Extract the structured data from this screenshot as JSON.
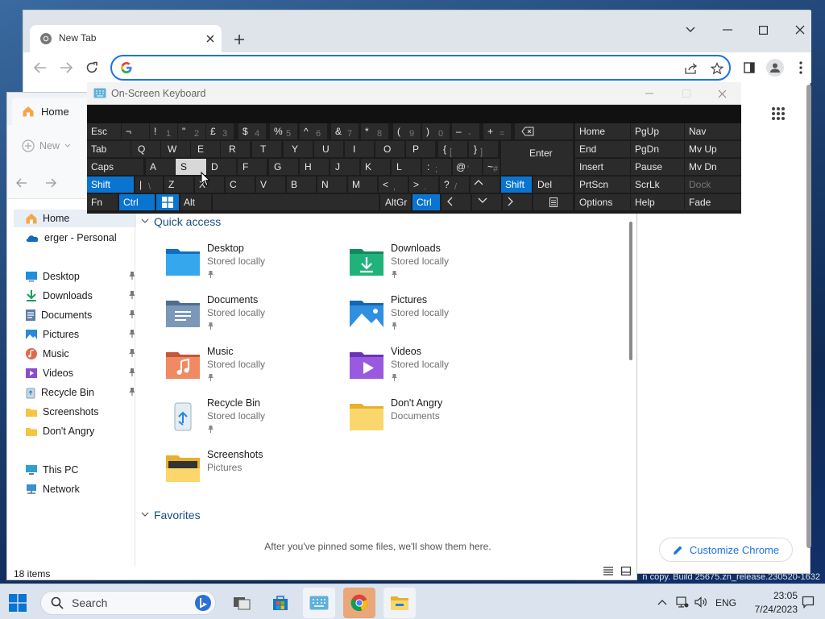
{
  "watermark": "n copy. Build 25675.zn_release.230520-1632",
  "chrome": {
    "tab_title": "New Tab",
    "omnibox_value": "",
    "customize_label": "Customize Chrome"
  },
  "explorer": {
    "tab_title": "Home",
    "new_label": "New",
    "nav": {
      "home": "Home",
      "onedrive": "erger - Personal",
      "desktop": "Desktop",
      "downloads": "Downloads",
      "documents": "Documents",
      "pictures": "Pictures",
      "music": "Music",
      "videos": "Videos",
      "recycle_bin": "Recycle Bin",
      "screenshots": "Screenshots",
      "dont_angry": "Don't Angry",
      "this_pc": "This PC",
      "network": "Network"
    },
    "quick_access_title": "Quick access",
    "quick_access": [
      {
        "name": "Desktop",
        "sub": "Stored locally"
      },
      {
        "name": "Downloads",
        "sub": "Stored locally"
      },
      {
        "name": "Documents",
        "sub": "Stored locally"
      },
      {
        "name": "Pictures",
        "sub": "Stored locally"
      },
      {
        "name": "Music",
        "sub": "Stored locally"
      },
      {
        "name": "Videos",
        "sub": "Stored locally"
      },
      {
        "name": "Recycle Bin",
        "sub": "Stored locally"
      },
      {
        "name": "Don't Angry",
        "sub": "Documents"
      },
      {
        "name": "Screenshots",
        "sub": "Pictures"
      }
    ],
    "favorites_title": "Favorites",
    "favorites_empty": "After you've pinned some files, we'll show them here.",
    "status_items": "18 items"
  },
  "osk": {
    "title": "On-Screen Keyboard",
    "keys": {
      "esc": "Esc",
      "not": "¬",
      "k1": "!",
      "k1s": "1",
      "k2": "\"",
      "k2s": "2",
      "k3": "£",
      "k3s": "3",
      "k4": "$",
      "k4s": "4",
      "k5": "%",
      "k5s": "5",
      "k6": "^",
      "k6s": "6",
      "k7": "&",
      "k7s": "7",
      "k8": "*",
      "k8s": "8",
      "k9": "(",
      "k9s": "9",
      "k0": ")",
      "k0s": "0",
      "minus": "–",
      "minuss": "-",
      "plus": "+",
      "pluss": "=",
      "tab": "Tab",
      "q": "Q",
      "w": "W",
      "e": "E",
      "r": "R",
      "t": "T",
      "y": "Y",
      "u": "U",
      "i": "I",
      "o": "O",
      "p": "P",
      "lbrace": "{",
      "lbraces": "[",
      "rbrace": "}",
      "rbraces": "]",
      "enter": "Enter",
      "caps": "Caps",
      "a": "A",
      "s": "S",
      "d": "D",
      "f": "F",
      "g": "G",
      "h": "H",
      "j": "J",
      "k": "K",
      "l": "L",
      "colon": ":",
      "colons": ";",
      "at": "@",
      "ats": "'",
      "tilde": "~",
      "tildes": "#",
      "shift": "Shift",
      "pipe": "|",
      "pipes": "\\",
      "z": "Z",
      "x": "X",
      "c": "C",
      "v": "V",
      "b": "B",
      "n": "N",
      "m": "M",
      "lt": "<",
      "lts": ",",
      "gt": ">",
      "gts": ".",
      "q2": "?",
      "q2s": "/",
      "shift_r": "Shift",
      "del": "Del",
      "fn": "Fn",
      "ctrl": "Ctrl",
      "alt": "Alt",
      "altgr": "AltGr",
      "ctrl_r": "Ctrl",
      "home": "Home",
      "pgup": "PgUp",
      "nav": "Nav",
      "end": "End",
      "pgdn": "PgDn",
      "mvup": "Mv Up",
      "insert": "Insert",
      "pause": "Pause",
      "mvdn": "Mv Dn",
      "prtscn": "PrtScn",
      "scrlk": "ScrLk",
      "dock": "Dock",
      "options": "Options",
      "help": "Help",
      "fade": "Fade"
    }
  },
  "taskbar": {
    "search_placeholder": "Search",
    "lang": "ENG",
    "time": "23:05",
    "date": "7/24/2023"
  },
  "colors": {
    "accent": "#0a74d1",
    "chrome_blue": "#1a73e8"
  }
}
